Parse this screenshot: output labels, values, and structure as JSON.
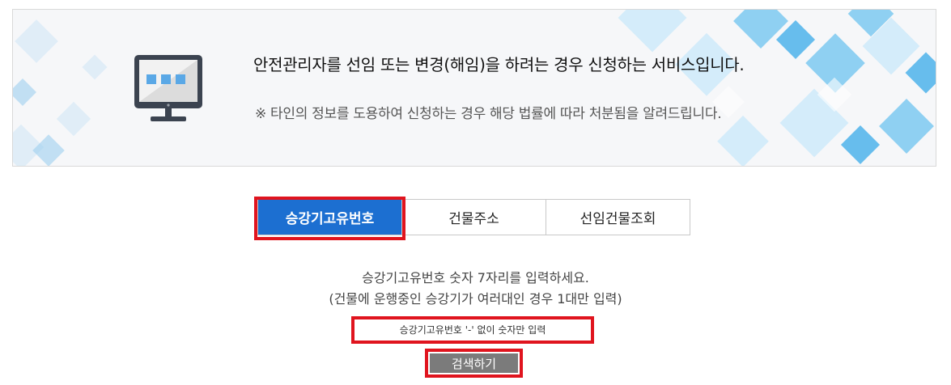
{
  "banner": {
    "line1": "안전관리자를 선임 또는 변경(해임)을 하려는 경우 신청하는 서비스입니다.",
    "line2": "※ 타인의 정보를 도용하여 신청하는 경우 해당 법률에 따라 처분됨을 알려드립니다."
  },
  "tabs": [
    {
      "label": "승강기고유번호",
      "active": true
    },
    {
      "label": "건물주소",
      "active": false
    },
    {
      "label": "선임건물조회",
      "active": false
    }
  ],
  "instructions": {
    "line1": "승강기고유번호 숫자 7자리를 입력하세요.",
    "line2": "(건물에 운행중인 승강기가 여러대인 경우 1대만 입력)"
  },
  "search": {
    "placeholder": "승강기고유번호 '-' 없이 숫자만 입력",
    "button_label": "검색하기"
  },
  "colors": {
    "accent": "#1c6fd1",
    "highlight": "#e0141e",
    "button": "#7b7b7b"
  },
  "icons": {
    "banner_icon": "monitor-icon"
  }
}
